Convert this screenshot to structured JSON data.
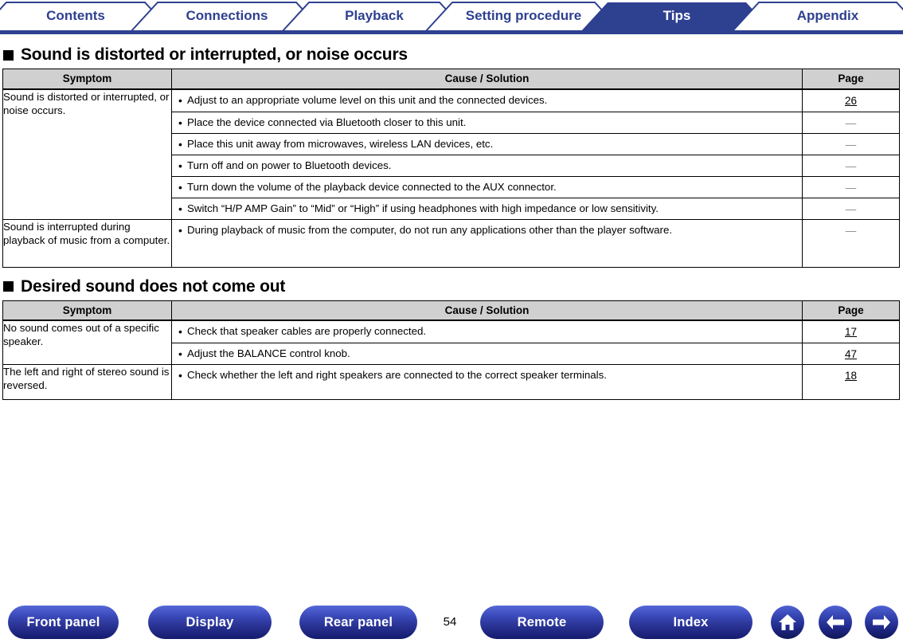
{
  "tabs": [
    {
      "label": "Contents",
      "active": false
    },
    {
      "label": "Connections",
      "active": false
    },
    {
      "label": "Playback",
      "active": false
    },
    {
      "label": "Setting procedure",
      "active": false
    },
    {
      "label": "Tips",
      "active": true
    },
    {
      "label": "Appendix",
      "active": false
    }
  ],
  "colors": {
    "brand_blue": "#2e4090",
    "header_gray": "#d0d0d0",
    "dash_gray": "#8c8c8c"
  },
  "columns": {
    "symptom": "Symptom",
    "cause": "Cause / Solution",
    "page": "Page"
  },
  "sections": [
    {
      "heading": "Sound is distorted or interrupted, or noise occurs",
      "rows": [
        {
          "symptom": "Sound is distorted or interrupted, or noise occurs.",
          "items": [
            {
              "text": "Adjust to an appropriate volume level on this unit and the connected devices.",
              "page": "26",
              "is_link": true
            },
            {
              "text": "Place the device connected via Bluetooth closer to this unit.",
              "page": "—",
              "is_link": false
            },
            {
              "text": "Place this unit away from microwaves, wireless LAN devices, etc.",
              "page": "—",
              "is_link": false
            },
            {
              "text": "Turn off and on power to Bluetooth devices.",
              "page": "—",
              "is_link": false
            },
            {
              "text": "Turn down the volume of the playback device connected to the AUX connector.",
              "page": "—",
              "is_link": false
            },
            {
              "text": "Switch “H/P AMP Gain” to “Mid” or “High” if using headphones with high impedance or low sensitivity.",
              "page": "—",
              "is_link": false
            }
          ]
        },
        {
          "symptom": "Sound is interrupted during playback of music from a computer.",
          "items": [
            {
              "text": "During playback of music from the computer, do not run any applications other than the player software.",
              "page": "—",
              "is_link": false
            }
          ]
        }
      ]
    },
    {
      "heading": "Desired sound does not come out",
      "rows": [
        {
          "symptom": "No sound comes out of a specific speaker.",
          "items": [
            {
              "text": "Check that speaker cables are properly connected.",
              "page": "17",
              "is_link": true
            },
            {
              "text": "Adjust the BALANCE control knob.",
              "page": "47",
              "is_link": true
            }
          ]
        },
        {
          "symptom": "The left and right of stereo sound is reversed.",
          "items": [
            {
              "text": "Check whether the left and right speakers are connected to the correct speaker terminals.",
              "page": "18",
              "is_link": true
            }
          ]
        }
      ]
    }
  ],
  "footer": {
    "buttons": [
      {
        "label": "Front panel"
      },
      {
        "label": "Display"
      },
      {
        "label": "Rear panel"
      },
      {
        "label": "Remote"
      },
      {
        "label": "Index"
      }
    ],
    "page_number": "54",
    "icons": [
      {
        "name": "home-icon"
      },
      {
        "name": "arrow-left-icon"
      },
      {
        "name": "arrow-right-icon"
      }
    ]
  }
}
